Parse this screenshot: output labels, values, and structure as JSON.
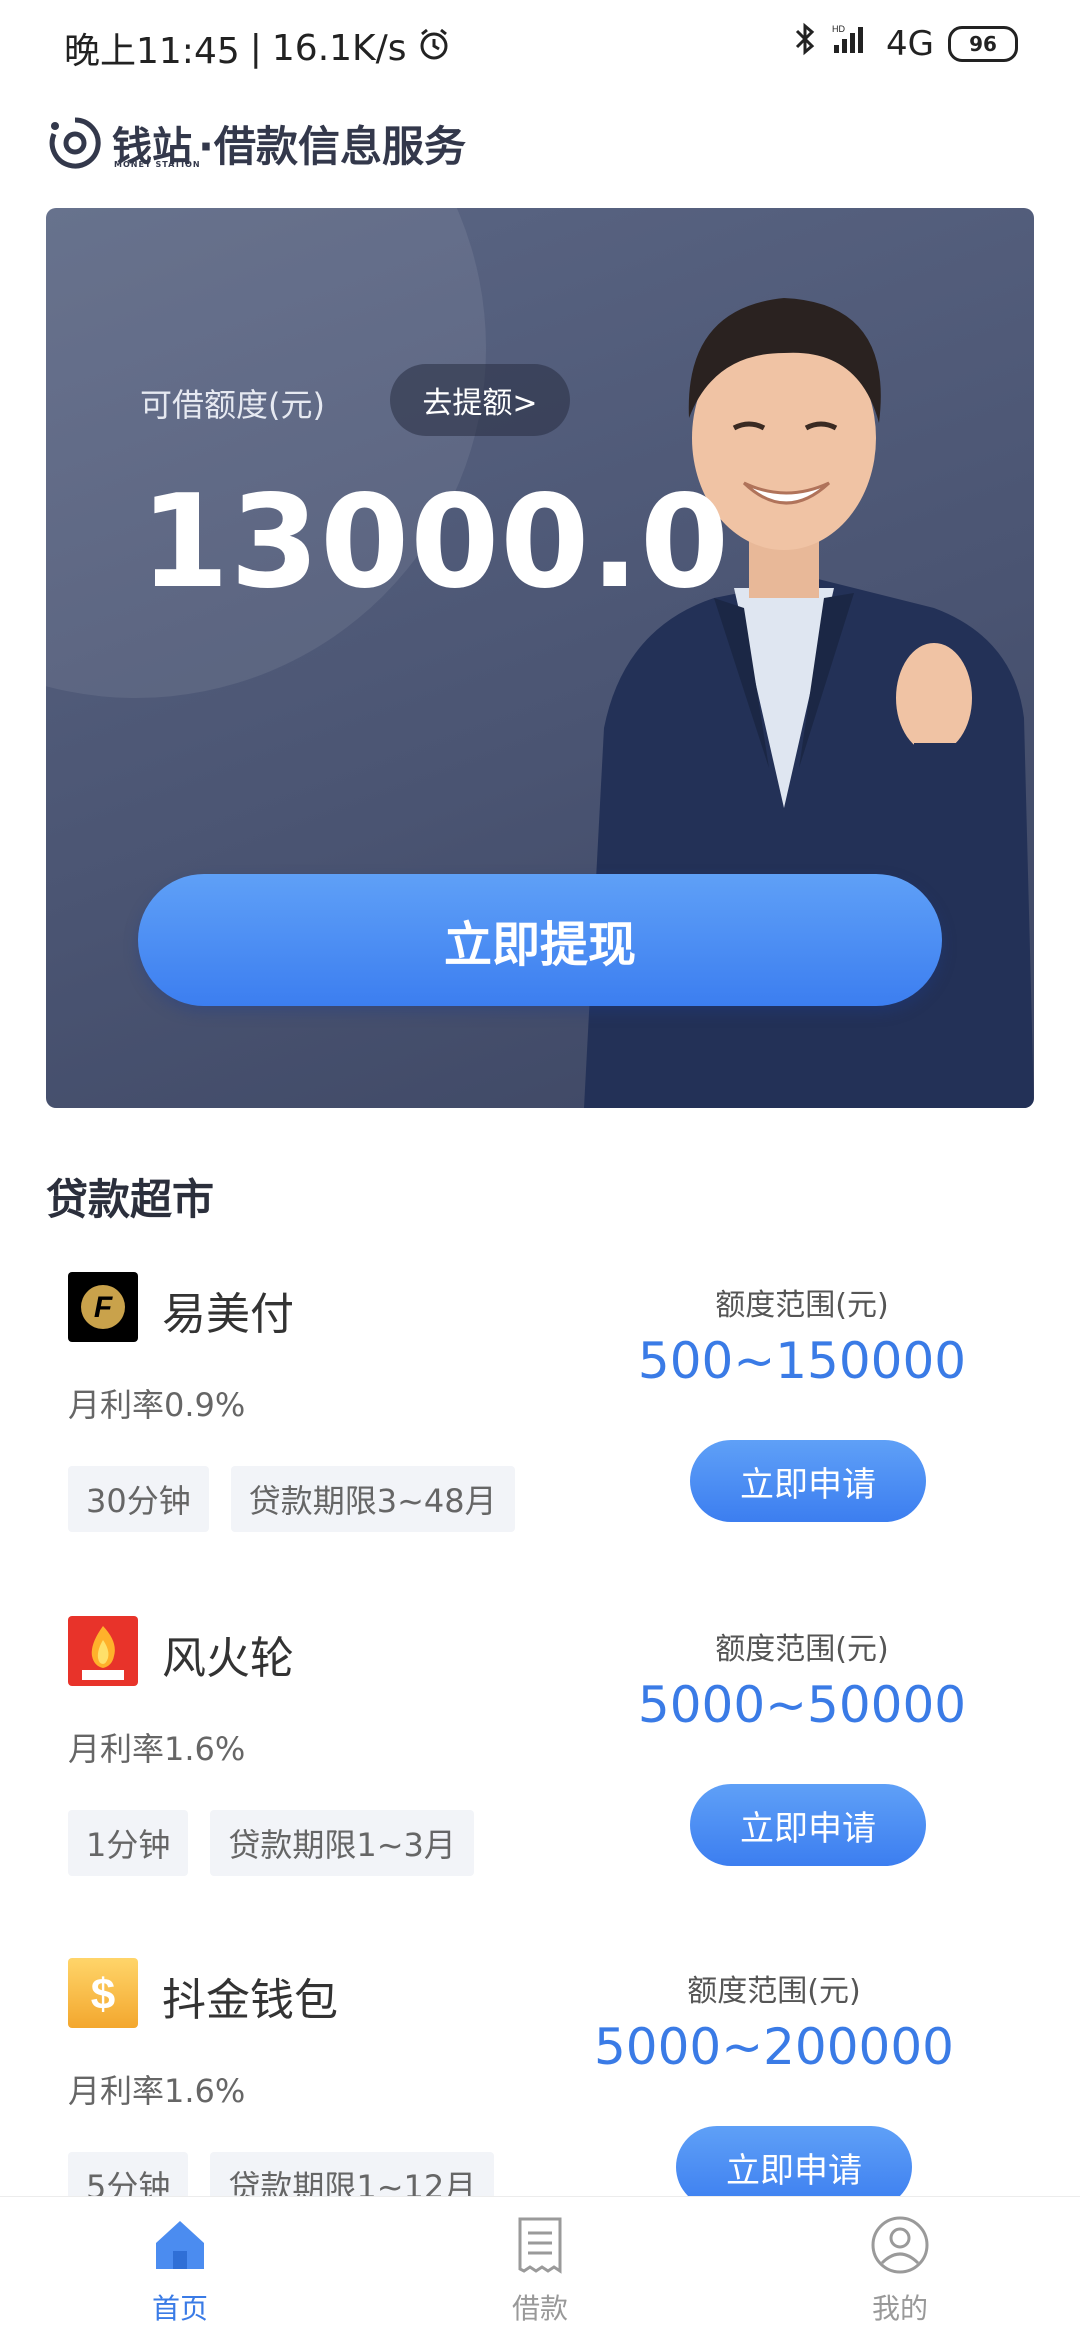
{
  "status_bar": {
    "time": "晚上11:45",
    "speed": "16.1K/s",
    "network": "4G",
    "battery": "96"
  },
  "header": {
    "brand": "钱站",
    "brand_sub": "MONEY STATION",
    "title": "·借款信息服务"
  },
  "banner": {
    "credit_label": "可借额度(元)",
    "raise_button": "去提额>",
    "credit_amount": "13000.0",
    "withdraw_button": "立即提现"
  },
  "market": {
    "title": "贷款超市",
    "range_label": "额度范围(元)",
    "apply_label": "立即申请",
    "items": [
      {
        "name": "易美付",
        "rate": "月利率0.9%",
        "tags": [
          "30分钟",
          "贷款期限3~48月"
        ],
        "range": "500~150000"
      },
      {
        "name": "风火轮",
        "rate": "月利率1.6%",
        "tags": [
          "1分钟",
          "贷款期限1~3月"
        ],
        "range": "5000~50000"
      },
      {
        "name": "抖金钱包",
        "rate": "月利率1.6%",
        "tags": [
          "5分钟",
          "贷款期限1~12月"
        ],
        "range": "5000~200000"
      }
    ]
  },
  "nav": {
    "items": [
      {
        "label": "首页"
      },
      {
        "label": "借款"
      },
      {
        "label": "我的"
      }
    ]
  },
  "colors": {
    "accent": "#3a7be6",
    "banner_bg": "#4b5573"
  }
}
